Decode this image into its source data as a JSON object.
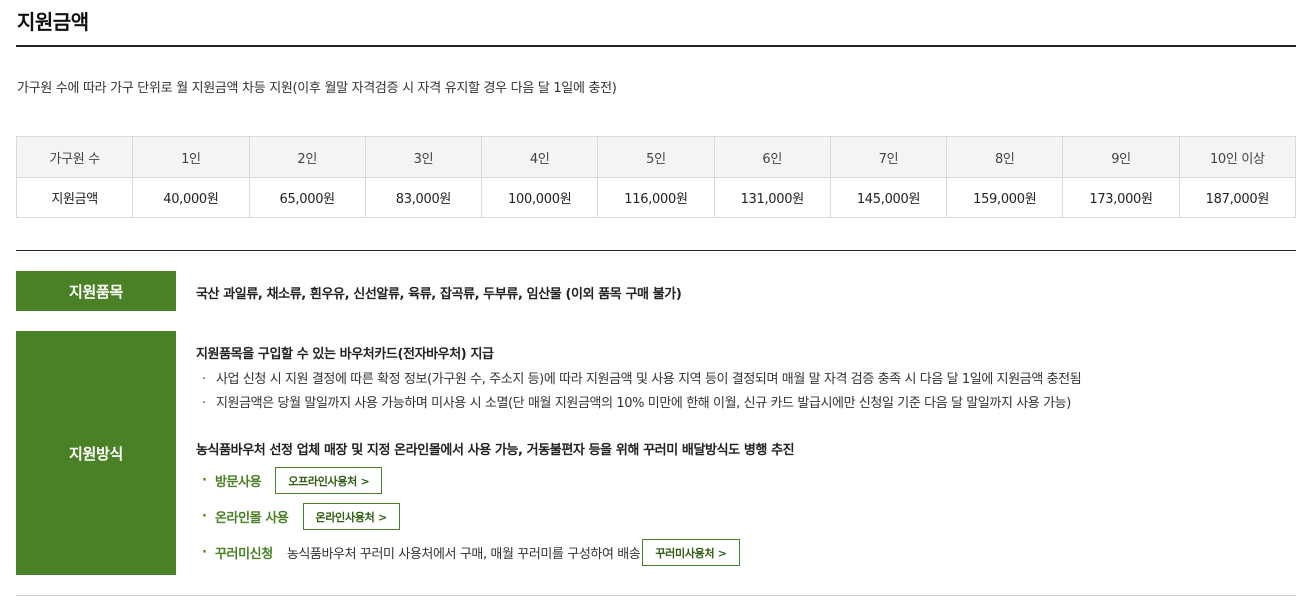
{
  "page_title": "지원금액",
  "intro": "가구원 수에 따라 가구 단위로 월 지원금액 차등 지원(이후 월말 자격검증 시 자격 유지할 경우 다음 달 1일에 충전)",
  "amount_table": {
    "head": [
      "가구원 수",
      "1인",
      "2인",
      "3인",
      "4인",
      "5인",
      "6인",
      "7인",
      "8인",
      "9인",
      "10인 이상"
    ],
    "body": [
      "지원금액",
      "40,000원",
      "65,000원",
      "83,000원",
      "100,000원",
      "116,000원",
      "131,000원",
      "145,000원",
      "159,000원",
      "173,000원",
      "187,000원"
    ]
  },
  "items": {
    "label": "지원품목",
    "text": "국산 과일류, 채소류, 흰우유, 신선알류, 육류, 잡곡류, 두부류, 임산물 (이외 품목 구매 불가)"
  },
  "method": {
    "label": "지원방식",
    "heading1": "지원품목을 구입할 수 있는 바우처카드(전자바우처) 지급",
    "bullets": [
      "사업 신청 시 지원 결정에 따른 확정 정보(가구원 수, 주소지 등)에 따라 지원금액 및 사용 지역 등이 결정되며 매월 말 자격 검증 충족 시 다음 달 1일에 지원금액 충전됨",
      "지원금액은 당월 말일까지 사용 가능하며 미사용 시 소멸(단 매월 지원금액의 10% 미만에 한해 이월, 신규 카드 발급시에만 신청일 기준 다음 달 말일까지 사용 가능)"
    ],
    "bullet_mark": "·",
    "heading2": "농식품바우처 선정 업체 매장 및 지정 온라인몰에서 사용 가능, 거동불편자 등을 위해 꾸러미 배달방식도 병행 추진",
    "uses": [
      {
        "label": "방문사용",
        "desc": "",
        "button": "오프라인사용처 >"
      },
      {
        "label": "온라인몰 사용",
        "desc": "",
        "button": "온라인사용처 >"
      },
      {
        "label": "꾸러미신청",
        "desc": "농식품바우처 꾸러미 사용처에서 구매, 매월 꾸러미를 구성하여 배송",
        "button": "꾸러미사용처 >"
      }
    ]
  },
  "colors": {
    "accent_green": "#4b8126",
    "table_header_bg": "#f4f4f4",
    "border": "#d9d9d9"
  }
}
